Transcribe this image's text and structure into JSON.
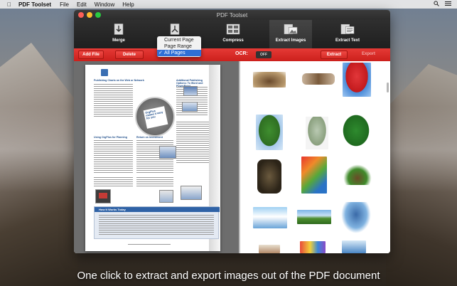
{
  "menubar": {
    "app_name": "PDF Toolset",
    "items": [
      "File",
      "Edit",
      "Window",
      "Help"
    ]
  },
  "window": {
    "title": "PDF Toolset"
  },
  "toolbar": {
    "merge": "Merge",
    "compress": "Compress",
    "extract_images": "Extract Images",
    "extract_text": "Extract Text"
  },
  "split_menu": {
    "options": [
      "Current Page",
      "Page Range",
      "All Pages"
    ],
    "selected": "All Pages",
    "check": "✓"
  },
  "actions": {
    "add_file": "Add File",
    "delete": "Delete",
    "ocr_label": "OCR:",
    "ocr_state": "OFF",
    "extract": "Extract",
    "export": "Export"
  },
  "pdf_page": {
    "heading_1": "Publishing Charts on the Web or Network",
    "heading_2": "Additional Publishing Options: To Word and PowerPoint",
    "heading_3": "Using OrgPlus for Planning",
    "heading_4": "Return on Investment",
    "banner_heading": "How It Works Today",
    "badge_text": "OrgPlus makes it easy for you"
  },
  "caption": "One click to extract and export images out of the PDF document",
  "colors": {
    "accent_red": "#d8261f",
    "toolbar_dark": "#262626",
    "selection_blue": "#2f6fd6"
  }
}
